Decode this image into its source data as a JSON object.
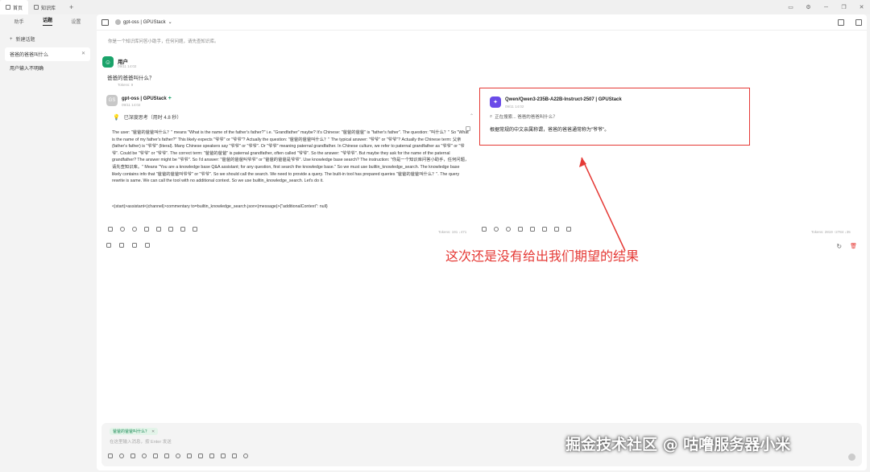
{
  "window": {
    "tabs": [
      {
        "label": "首页",
        "icon": "home-icon"
      },
      {
        "label": "知识库",
        "icon": "book-icon"
      }
    ]
  },
  "sidebar": {
    "tabs": [
      "助手",
      "话题",
      "设置"
    ],
    "active_tab": "话题",
    "new_topic_label": "新建话题",
    "topics": [
      "爸爸的爸爸叫什么",
      "用户输入不明确"
    ]
  },
  "header": {
    "model": "gpt-oss | GPUStack"
  },
  "system_prompt": "你是一个知识库问答小助手，任何问题，请先查知识库。",
  "user_message": {
    "name": "用户",
    "time": "09/11 14:02",
    "text": "爸爸的爸爸叫什么？",
    "tokens": "Tokens: 9"
  },
  "left_answer": {
    "model": "gpt-oss | GPUStack",
    "time": "09/11 14:02",
    "thinking_label": "已深度思考（用时 4.8 秒）",
    "reasoning": "The user: \"爸爸的爸爸叫什么？\" means \"What is the name of the father's father?\" i.e. \"Grandfather\" maybe? It's Chinese: \"爸爸的爸爸\" is \"father's father\". The question: \"叫什么？\" So \"What is the name of my father's father?\" This likely expects \"爷爷\" or \"爷爷\"? Actually the question: \"爸爸的爸爸叫什么？\" The typical answer: \"爷爷\" or \"爷爷\"? Actually the Chinese term: 父亲 (father's father) is \"爷爷\" (literal). Many Chinese speakers say \"爷爷\" or \"爷爷\". Or \"爷爷\" meaning paternal grandfather. In Chinese culture, we refer to paternal grandfather as \"爷爷\" or \"爷爷\". Could be \"爷爷\" or \"爷爷\". The correct term: \"爸爸的爸爸\" is paternal grandfather, often called \"爷爷\". So the answer: \"爷爷爷\". But maybe they ask for the name of the paternal grandfather? The answer might be \"爷爷\". So I'd answer: \"爸爸的爸爸叫爷爷\" or \"爸爸的爸爸是爷爷\". Use knowledge base search? The instruction: \"你是一个知识库问答小助手，任何问题，请先查知识库。\" Means \"You are a knowledge base Q&A assistant; for any question, first search the knowledge base.\" So we must use builtin_knowledge_search. The knowledge base likely contains info that \"爸爸的爸爸叫爷爷\" or \"爷爷\". So we should call the search. We need to provide a query. The built-in tool has prepared queries \"爸爸的爸爸叫什么？\". The query rewrite is same. We can call the tool with no additional context. So we use builtin_knowledge_search. Let's do it.",
    "tool_call": "<|start|>assistant<|channel|>commentary to=builtin_knowledge_search json<|message|>{\"additionalContext\": null}",
    "tokens": "Tokens: 191 ↓471"
  },
  "right_answer": {
    "model": "Qwen/Qwen3-235B-A22B-Instruct-2507 | GPUStack",
    "time": "09/11 14:02",
    "search_text": "正在搜索... 爸爸的爸爸叫什么？",
    "text": "根据常规的中文亲属称谓，爸爸的爸爸通常称为\"爷爷\"。",
    "tokens": "Tokens: 2819 ↑2784 ↓35"
  },
  "annotation": "这次还是没有给出我们期望的结果",
  "input": {
    "chip": "爸爸的爸爸叫什么？",
    "placeholder": "在这里输入消息，按 Enter 发送"
  },
  "watermark": "掘金技术社区 @ 咕噜服务器小米",
  "colors": {
    "accent": "#1aa36a",
    "highlight": "#e53935",
    "qwen": "#6a4be8"
  }
}
